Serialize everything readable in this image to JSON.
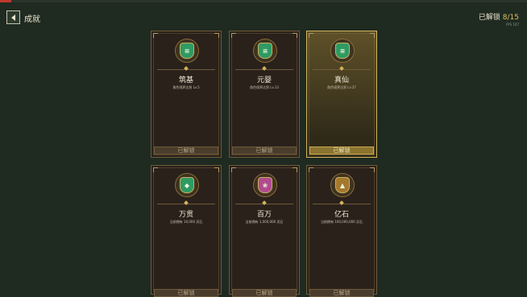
{
  "header": {
    "title": "成就",
    "unlocked_label": "已解锁",
    "unlocked_count": "8/15",
    "fps": "FPS 107"
  },
  "cards": [
    {
      "name": "筑基",
      "condition": "角色境界达到 Lv.5",
      "status": "已解锁",
      "icon": "green-pill-icon",
      "glyph": "≡"
    },
    {
      "name": "元婴",
      "condition": "角色境界达到 Lv.13",
      "status": "已解锁",
      "icon": "green-pill-icon",
      "glyph": "≡"
    },
    {
      "name": "真仙",
      "condition": "角色境界达到 Lv.27",
      "status": "已解锁",
      "icon": "green-pill-icon",
      "glyph": "≡"
    },
    {
      "name": "万贯",
      "condition": "当前拥有 10,000 灵石",
      "status": "已解锁",
      "icon": "green-coin-icon",
      "glyph": "◆"
    },
    {
      "name": "百万",
      "condition": "当前拥有 1,000,000 灵石",
      "status": "已解锁",
      "icon": "pink-gem-icon",
      "glyph": "❀"
    },
    {
      "name": "亿石",
      "condition": "当前拥有 100,000,000 灵石",
      "status": "已解锁",
      "icon": "gold-pyramid-icon",
      "glyph": "▲"
    }
  ],
  "colors": {
    "accent": "#e2c15a",
    "background": "#1f2a21",
    "card_border": "#6e5a38",
    "highlight_border": "#d2b45e"
  }
}
